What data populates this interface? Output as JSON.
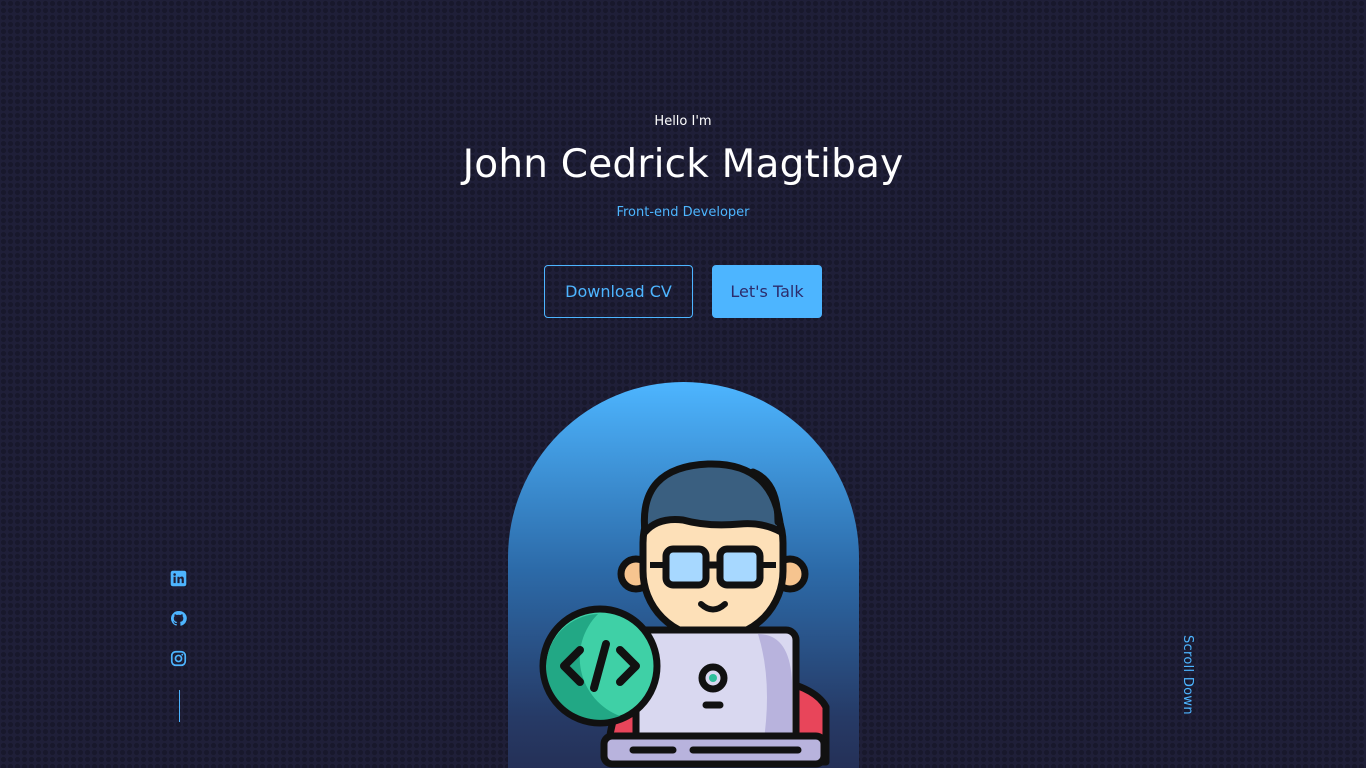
{
  "header": {
    "greeting": "Hello I'm",
    "name": "John Cedrick Magtibay",
    "role": "Front-end Developer"
  },
  "actions": {
    "download_cv_label": "Download CV",
    "lets_talk_label": "Let's Talk"
  },
  "socials": {
    "items": [
      {
        "icon": "linkedin-icon"
      },
      {
        "icon": "github-icon"
      },
      {
        "icon": "instagram-icon"
      }
    ]
  },
  "scroll": {
    "label": "Scroll Down"
  },
  "theme": {
    "background": "#1f1f38",
    "accent": "#4db5ff",
    "button_text": "#2c2c6c"
  }
}
